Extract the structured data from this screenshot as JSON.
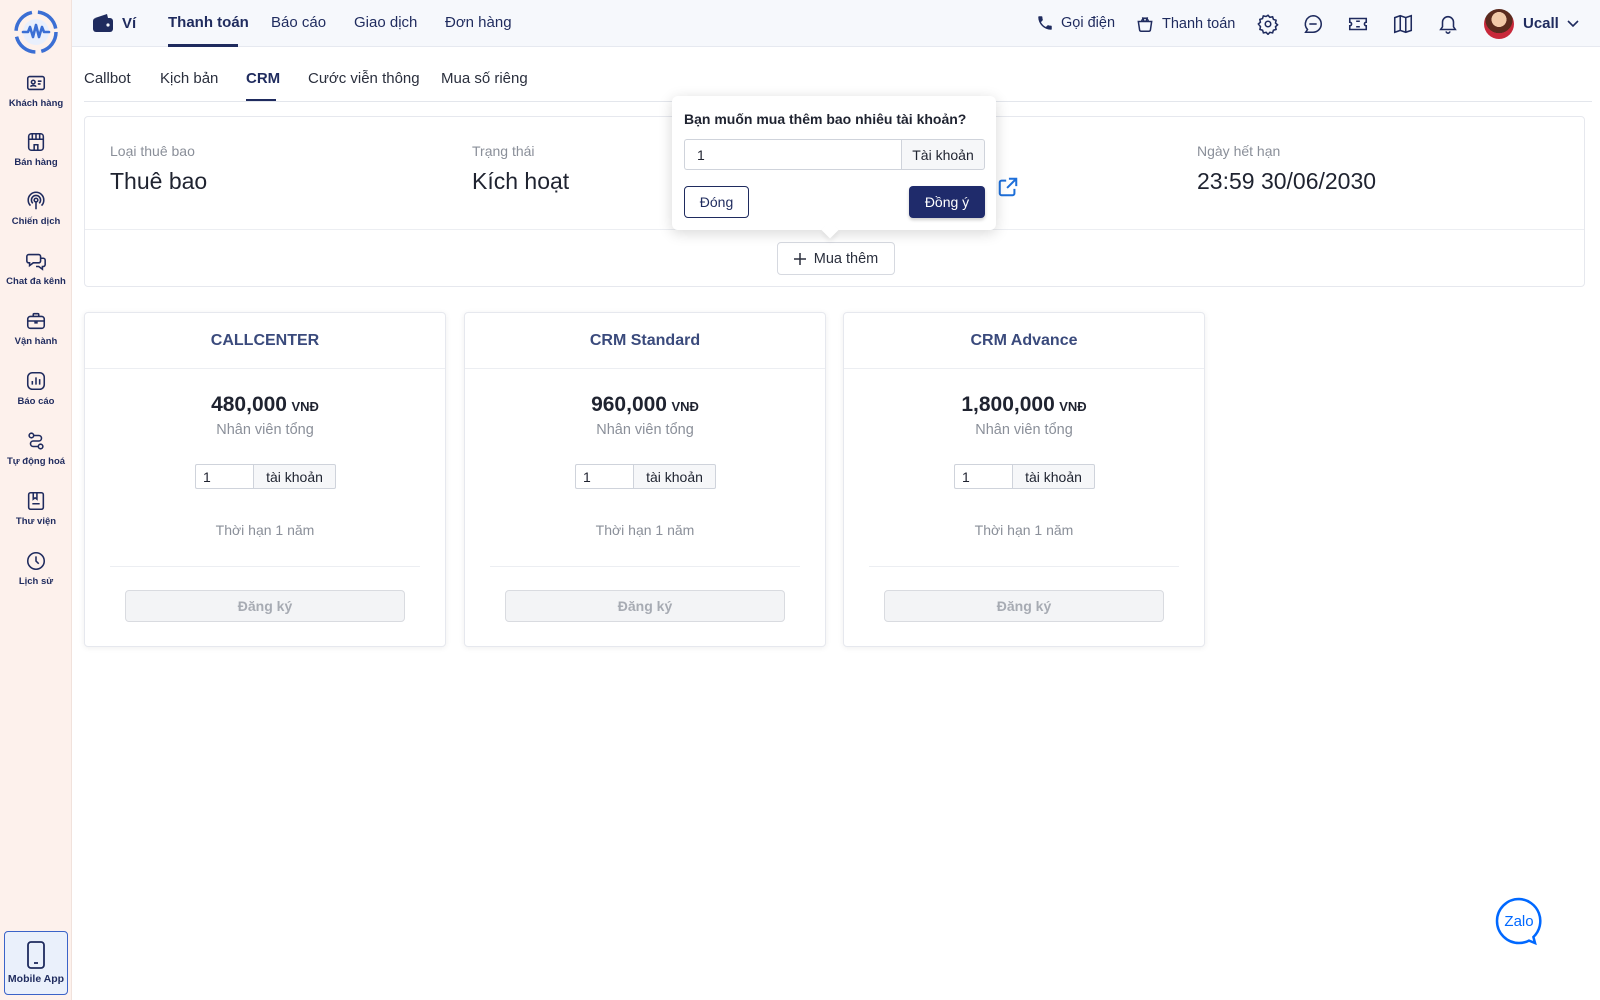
{
  "sidebar": {
    "items": [
      {
        "label": "Khách hàng",
        "icon": "contact-card-icon"
      },
      {
        "label": "Bán hàng",
        "icon": "storefront-icon"
      },
      {
        "label": "Chiến dịch",
        "icon": "broadcast-icon"
      },
      {
        "label": "Chat đa kênh",
        "icon": "chat-bubbles-icon"
      },
      {
        "label": "Vận hành",
        "icon": "briefcase-icon"
      },
      {
        "label": "Báo cáo",
        "icon": "bar-chart-icon"
      },
      {
        "label": "Tự động hoá",
        "icon": "workflow-icon"
      },
      {
        "label": "Thư viện",
        "icon": "library-icon"
      },
      {
        "label": "Lịch sử",
        "icon": "clock-icon"
      }
    ],
    "mobile_app_label": "Mobile App"
  },
  "topbar": {
    "wallet_label": "Ví",
    "tabs": [
      {
        "label": "Thanh toán",
        "active": true
      },
      {
        "label": "Báo cáo",
        "active": false
      },
      {
        "label": "Giao dịch",
        "active": false
      },
      {
        "label": "Đơn hàng",
        "active": false
      }
    ],
    "call_label": "Gọi điện",
    "payment_label": "Thanh toán",
    "user_name": "Ucall"
  },
  "subtabs": [
    {
      "label": "Callbot",
      "active": false
    },
    {
      "label": "Kịch bản",
      "active": false
    },
    {
      "label": "CRM",
      "active": true
    },
    {
      "label": "Cước viễn thông",
      "active": false
    },
    {
      "label": "Mua số riêng",
      "active": false
    }
  ],
  "subscription": {
    "type_label": "Loại thuê bao",
    "type_value": "Thuê bao",
    "status_label": "Trạng thái",
    "status_value": "Kích hoạt",
    "expiry_label": "Ngày hết hạn",
    "expiry_value": "23:59 30/06/2030",
    "buy_more_label": "Mua thêm"
  },
  "popover": {
    "question": "Bạn muốn mua thêm bao nhiêu tài khoản?",
    "quantity": "1",
    "unit": "Tài khoản",
    "close_label": "Đóng",
    "confirm_label": "Đồng ý"
  },
  "plans": [
    {
      "name": "CALLCENTER",
      "price": "480,000",
      "currency": "VNĐ",
      "subtitle": "Nhân viên tổng",
      "quantity": "1",
      "unit": "tài khoản",
      "term": "Thời hạn 1 năm",
      "button": "Đăng ký"
    },
    {
      "name": "CRM Standard",
      "price": "960,000",
      "currency": "VNĐ",
      "subtitle": "Nhân viên tổng",
      "quantity": "1",
      "unit": "tài khoản",
      "term": "Thời hạn 1 năm",
      "button": "Đăng ký"
    },
    {
      "name": "CRM Advance",
      "price": "1,800,000",
      "currency": "VNĐ",
      "subtitle": "Nhân viên tổng",
      "quantity": "1",
      "unit": "tài khoản",
      "term": "Thời hạn 1 năm",
      "button": "Đăng ký"
    }
  ],
  "zalo_label": "Zalo",
  "colors": {
    "primary": "#1f2b6b",
    "nav_text": "#1f2b5e",
    "sidebar_bg": "#fdf1ec",
    "link_blue": "#1e6fd9",
    "zalo_blue": "#0068ff"
  }
}
